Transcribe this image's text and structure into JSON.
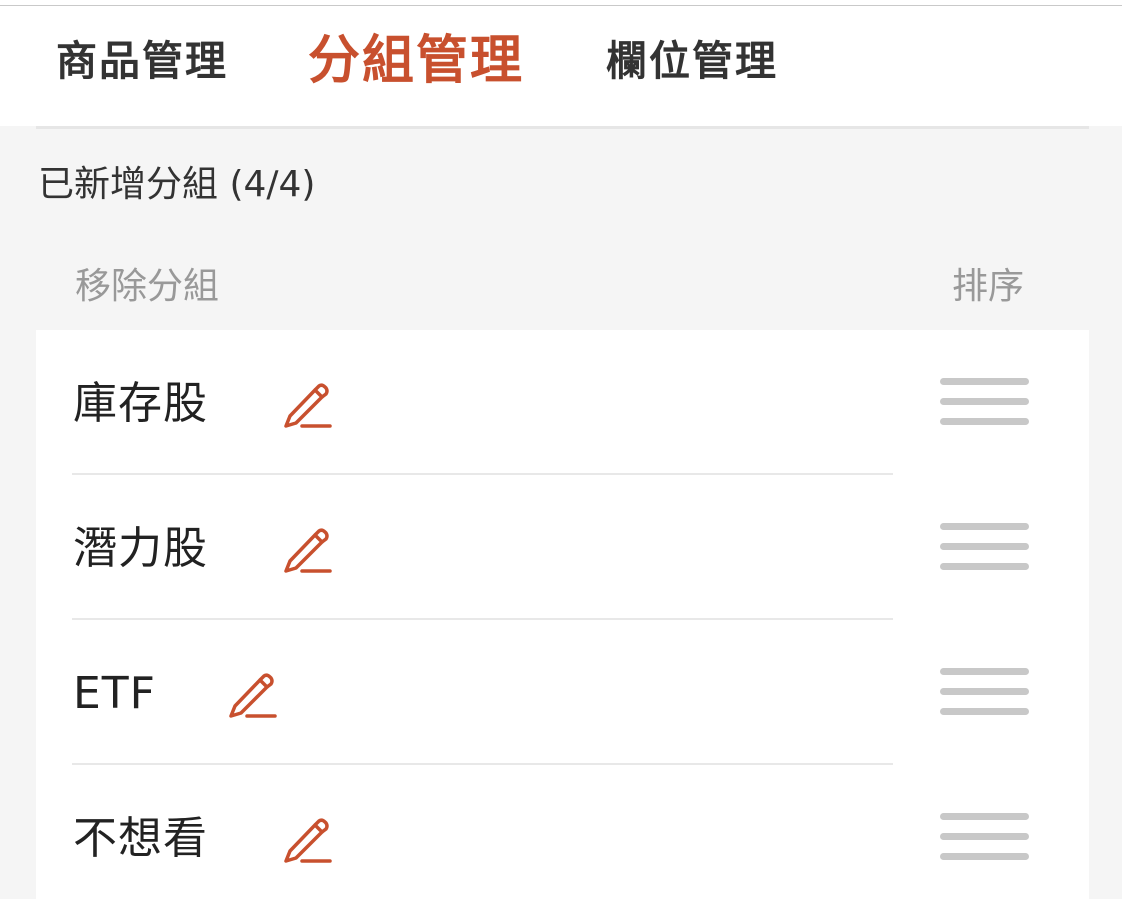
{
  "tabs": [
    {
      "label": "商品管理",
      "active": false
    },
    {
      "label": "分組管理",
      "active": true
    },
    {
      "label": "欄位管理",
      "active": false
    }
  ],
  "section": {
    "title": "已新增分組 (4/4)",
    "remove_header": "移除分組",
    "sort_header": "排序"
  },
  "groups": [
    {
      "name": "庫存股"
    },
    {
      "name": "潛力股"
    },
    {
      "name": "ETF"
    },
    {
      "name": "不想看"
    }
  ],
  "colors": {
    "accent": "#c8502e",
    "handle": "#c8c8c8",
    "background": "#f5f5f5"
  },
  "icons": {
    "edit": "pencil-icon",
    "sort": "drag-handle-icon"
  }
}
